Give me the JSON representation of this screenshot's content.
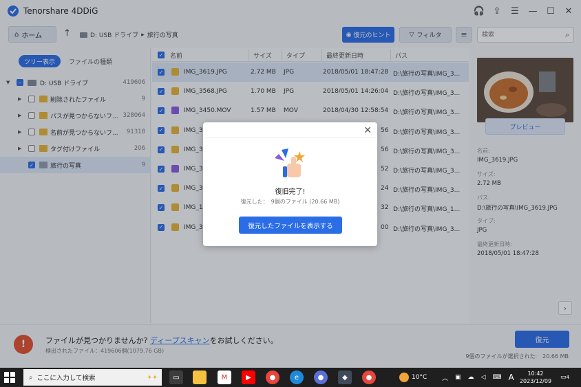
{
  "app": {
    "title": "Tenorshare 4DDiG",
    "accent": "#2b6de6"
  },
  "window_controls": [
    "headset-icon",
    "share-icon",
    "menu-icon",
    "minimize-icon",
    "maximize-icon",
    "close-icon"
  ],
  "toolbar": {
    "home_label": "ホーム",
    "breadcrumb": [
      "D: USB ドライブ",
      "旅行の写真"
    ],
    "hint_label": "復元のヒント",
    "filter_label": "フィルタ",
    "search_placeholder": "検索"
  },
  "sidebar": {
    "tabs": [
      "ツリー表示",
      "ファイルの種類"
    ],
    "active_tab": "ツリー表示",
    "tree": [
      {
        "label": "D: USB ドライブ",
        "count": "419606",
        "level": 0,
        "state": "partial",
        "icon": "drive-icon"
      },
      {
        "label": "削除されたファイル",
        "count": "9",
        "level": 1,
        "state": "unchecked",
        "icon": "folder-icon"
      },
      {
        "label": "パスが見つからないフ...",
        "count": "328064",
        "level": 1,
        "state": "unchecked",
        "icon": "folder-icon"
      },
      {
        "label": "名前が見つからないフ...",
        "count": "91318",
        "level": 1,
        "state": "unchecked",
        "icon": "folder-icon"
      },
      {
        "label": "タグ付けファイル",
        "count": "206",
        "level": 1,
        "state": "unchecked",
        "icon": "folder-icon"
      },
      {
        "label": "旅行の写真",
        "count": "9",
        "level": 1,
        "state": "checked",
        "icon": "folder-icon",
        "selected": true
      }
    ]
  },
  "table": {
    "headers": [
      "名前",
      "サイズ",
      "タイプ",
      "最終更新日時",
      "パス"
    ],
    "rows": [
      {
        "name": "IMG_3619.JPG",
        "size": "2.72 MB",
        "type": "JPG",
        "date": "2018/05/01 18:47:28",
        "path": "D:\\旅行の写真\\IMG_3...",
        "kind": "img"
      },
      {
        "name": "IMG_3568.JPG",
        "size": "1.70 MB",
        "type": "JPG",
        "date": "2018/05/01 14:26:04",
        "path": "D:\\旅行の写真\\IMG_3...",
        "kind": "img"
      },
      {
        "name": "IMG_3450.MOV",
        "size": "1.57 MB",
        "type": "MOV",
        "date": "2018/04/30 12:58:54",
        "path": "D:\\旅行の写真\\IMG_3...",
        "kind": "mov"
      },
      {
        "name": "IMG_3",
        "size": "",
        "type": "",
        "date": "56",
        "path": "D:\\旅行の写真\\IMG_3...",
        "kind": "img"
      },
      {
        "name": "IMG_3",
        "size": "",
        "type": "",
        "date": "56",
        "path": "D:\\旅行の写真\\IMG_3...",
        "kind": "img"
      },
      {
        "name": "IMG_3",
        "size": "",
        "type": "",
        "date": "52",
        "path": "D:\\旅行の写真\\IMG_3...",
        "kind": "mov"
      },
      {
        "name": "IMG_3",
        "size": "",
        "type": "",
        "date": "24",
        "path": "D:\\旅行の写真\\IMG_3...",
        "kind": "img"
      },
      {
        "name": "IMG_1",
        "size": "",
        "type": "",
        "date": "32",
        "path": "D:\\旅行の写真\\IMG_1...",
        "kind": "img"
      },
      {
        "name": "IMG_3",
        "size": "",
        "type": "",
        "date": "00",
        "path": "D:\\旅行の写真\\IMG_3...",
        "kind": "img"
      }
    ]
  },
  "preview": {
    "button_label": "プレビュー",
    "fields": [
      {
        "key": "名前:",
        "value": "IMG_3619.JPG"
      },
      {
        "key": "サイズ:",
        "value": "2.72 MB"
      },
      {
        "key": "パス:",
        "value": "D:\\旅行の写真\\IMG_3619.JPG"
      },
      {
        "key": "タイプ:",
        "value": "JPG"
      },
      {
        "key": "最終更新日時:",
        "value": "2018/05/01 18:47:28"
      }
    ]
  },
  "bottom": {
    "notfound_prefix": "ファイルが見つかりませんか? ",
    "notfound_link": "ディープスキャン",
    "notfound_suffix": "をお試しください。",
    "scanned": "検出されたファイル：419606個(1079.76 GB)",
    "recover_label": "復元",
    "selected_info": "9個のファイルが選択された:　20.66 MB"
  },
  "modal": {
    "title": "復旧完了!",
    "subtitle": "復元した：　9個のファイル (20.66 MB)",
    "button_label": "復元したファイルを表示する"
  },
  "taskbar": {
    "search_placeholder": "ここに入力して検索",
    "temperature": "10°C",
    "ime": "A",
    "time": "10:42",
    "date": "2023/12/09",
    "notification_count": "4"
  }
}
